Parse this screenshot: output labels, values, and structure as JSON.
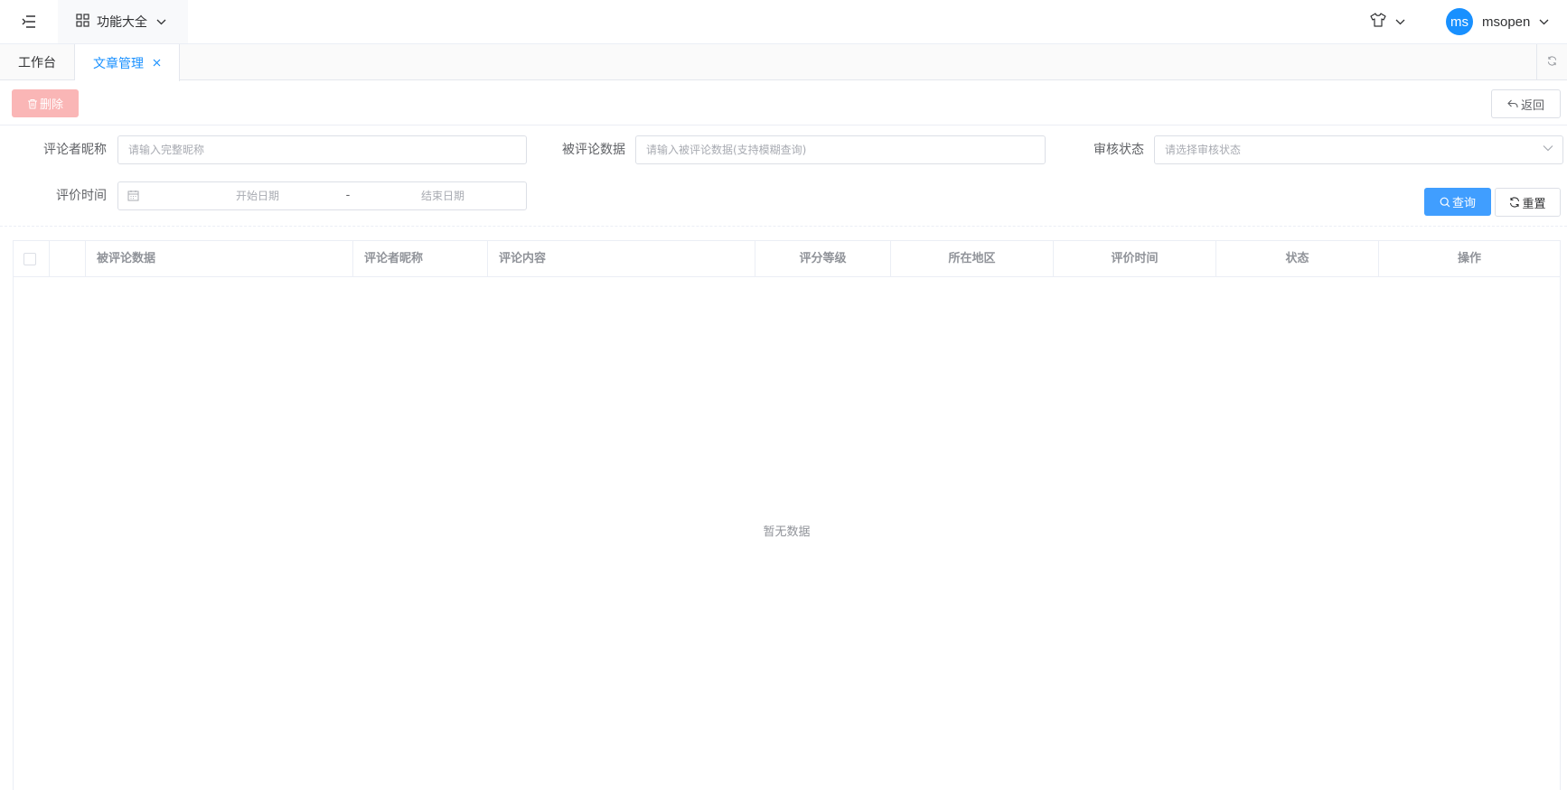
{
  "header": {
    "menu_label": "功能大全",
    "username": "msopen",
    "avatar_text": "ms"
  },
  "tabs": [
    {
      "label": "工作台"
    },
    {
      "label": "文章管理"
    }
  ],
  "toolbar": {
    "delete_label": "删除",
    "back_label": "返回"
  },
  "filters": {
    "nickname": {
      "label": "评论者昵称",
      "placeholder": "请输入完整昵称"
    },
    "target": {
      "label": "被评论数据",
      "placeholder": "请输入被评论数据(支持模糊查询)"
    },
    "status": {
      "label": "审核状态",
      "placeholder": "请选择审核状态"
    },
    "time": {
      "label": "评价时间",
      "start_placeholder": "开始日期",
      "separator": "-",
      "end_placeholder": "结束日期"
    },
    "query_label": "查询",
    "reset_label": "重置"
  },
  "table": {
    "columns": [
      "被评论数据",
      "评论者昵称",
      "评论内容",
      "评分等级",
      "所在地区",
      "评价时间",
      "状态",
      "操作"
    ],
    "empty_text": "暂无数据"
  },
  "colors": {
    "primary": "#409eff",
    "active_tab": "#1890ff",
    "danger_disabled": "#fab6b6",
    "avatar": "#1890ff"
  }
}
